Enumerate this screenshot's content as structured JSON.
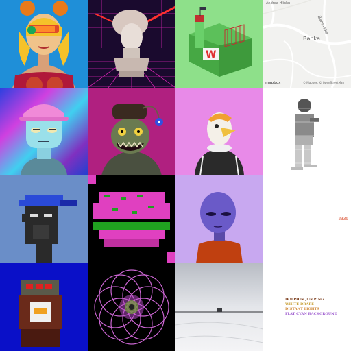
{
  "tiles": [
    {
      "id": 1,
      "subject": "pigtails-girl-with-visor"
    },
    {
      "id": 2,
      "subject": "medusa-bust-synthwave"
    },
    {
      "id": 3,
      "subject": "green-fortress-w-logo"
    },
    {
      "id": 4,
      "subject": "street-map",
      "map": {
        "place_label": "Banka",
        "road_label": "Banavska",
        "road_label_top": "Andrea Hlinku",
        "attribution": "© Mapbox, © OpenStreetMap",
        "logo": "mapbox"
      }
    },
    {
      "id": 5,
      "subject": "holographic-pink-cap-character"
    },
    {
      "id": 6,
      "subject": "anglerfish-zombie"
    },
    {
      "id": 7,
      "subject": "eagle-in-tracksuit"
    },
    {
      "id": 8,
      "subject": "ascii-person-with-phone"
    },
    {
      "id": 9,
      "subject": "pixel-ape-blue-cap"
    },
    {
      "id": 10,
      "subject": "pixel-burger"
    },
    {
      "id": 11,
      "subject": "purple-alien"
    },
    {
      "id": 12,
      "subject": "number-tile",
      "number": "2339"
    },
    {
      "id": 13,
      "subject": "voxel-robot-duck"
    },
    {
      "id": 14,
      "subject": "pink-spirograph"
    },
    {
      "id": 15,
      "subject": "snowy-landscape-car"
    },
    {
      "id": 16,
      "subject": "text-tile",
      "lines": [
        {
          "text": "DOLPHIN JUMPING",
          "color": "#7a3b1a"
        },
        {
          "text": "WHITE DRAPE",
          "color": "#c9a23a"
        },
        {
          "text": "DISTANT LIGHTS",
          "color": "#d08a3a"
        },
        {
          "text": "FLAT CYAN BACKGROUND",
          "color": "#a060d0"
        }
      ]
    }
  ],
  "colors": {
    "blue_bg": "#1f8fd8",
    "synth_bg": "#1a0a2e",
    "green_bg": "#8ee08a",
    "map_bg": "#f2f2f0",
    "pink_bg": "#e88ae8",
    "lavender_bg": "#c8a8f0",
    "deep_blue_bg": "#0a10c8",
    "number_color": "#d94a2a"
  }
}
